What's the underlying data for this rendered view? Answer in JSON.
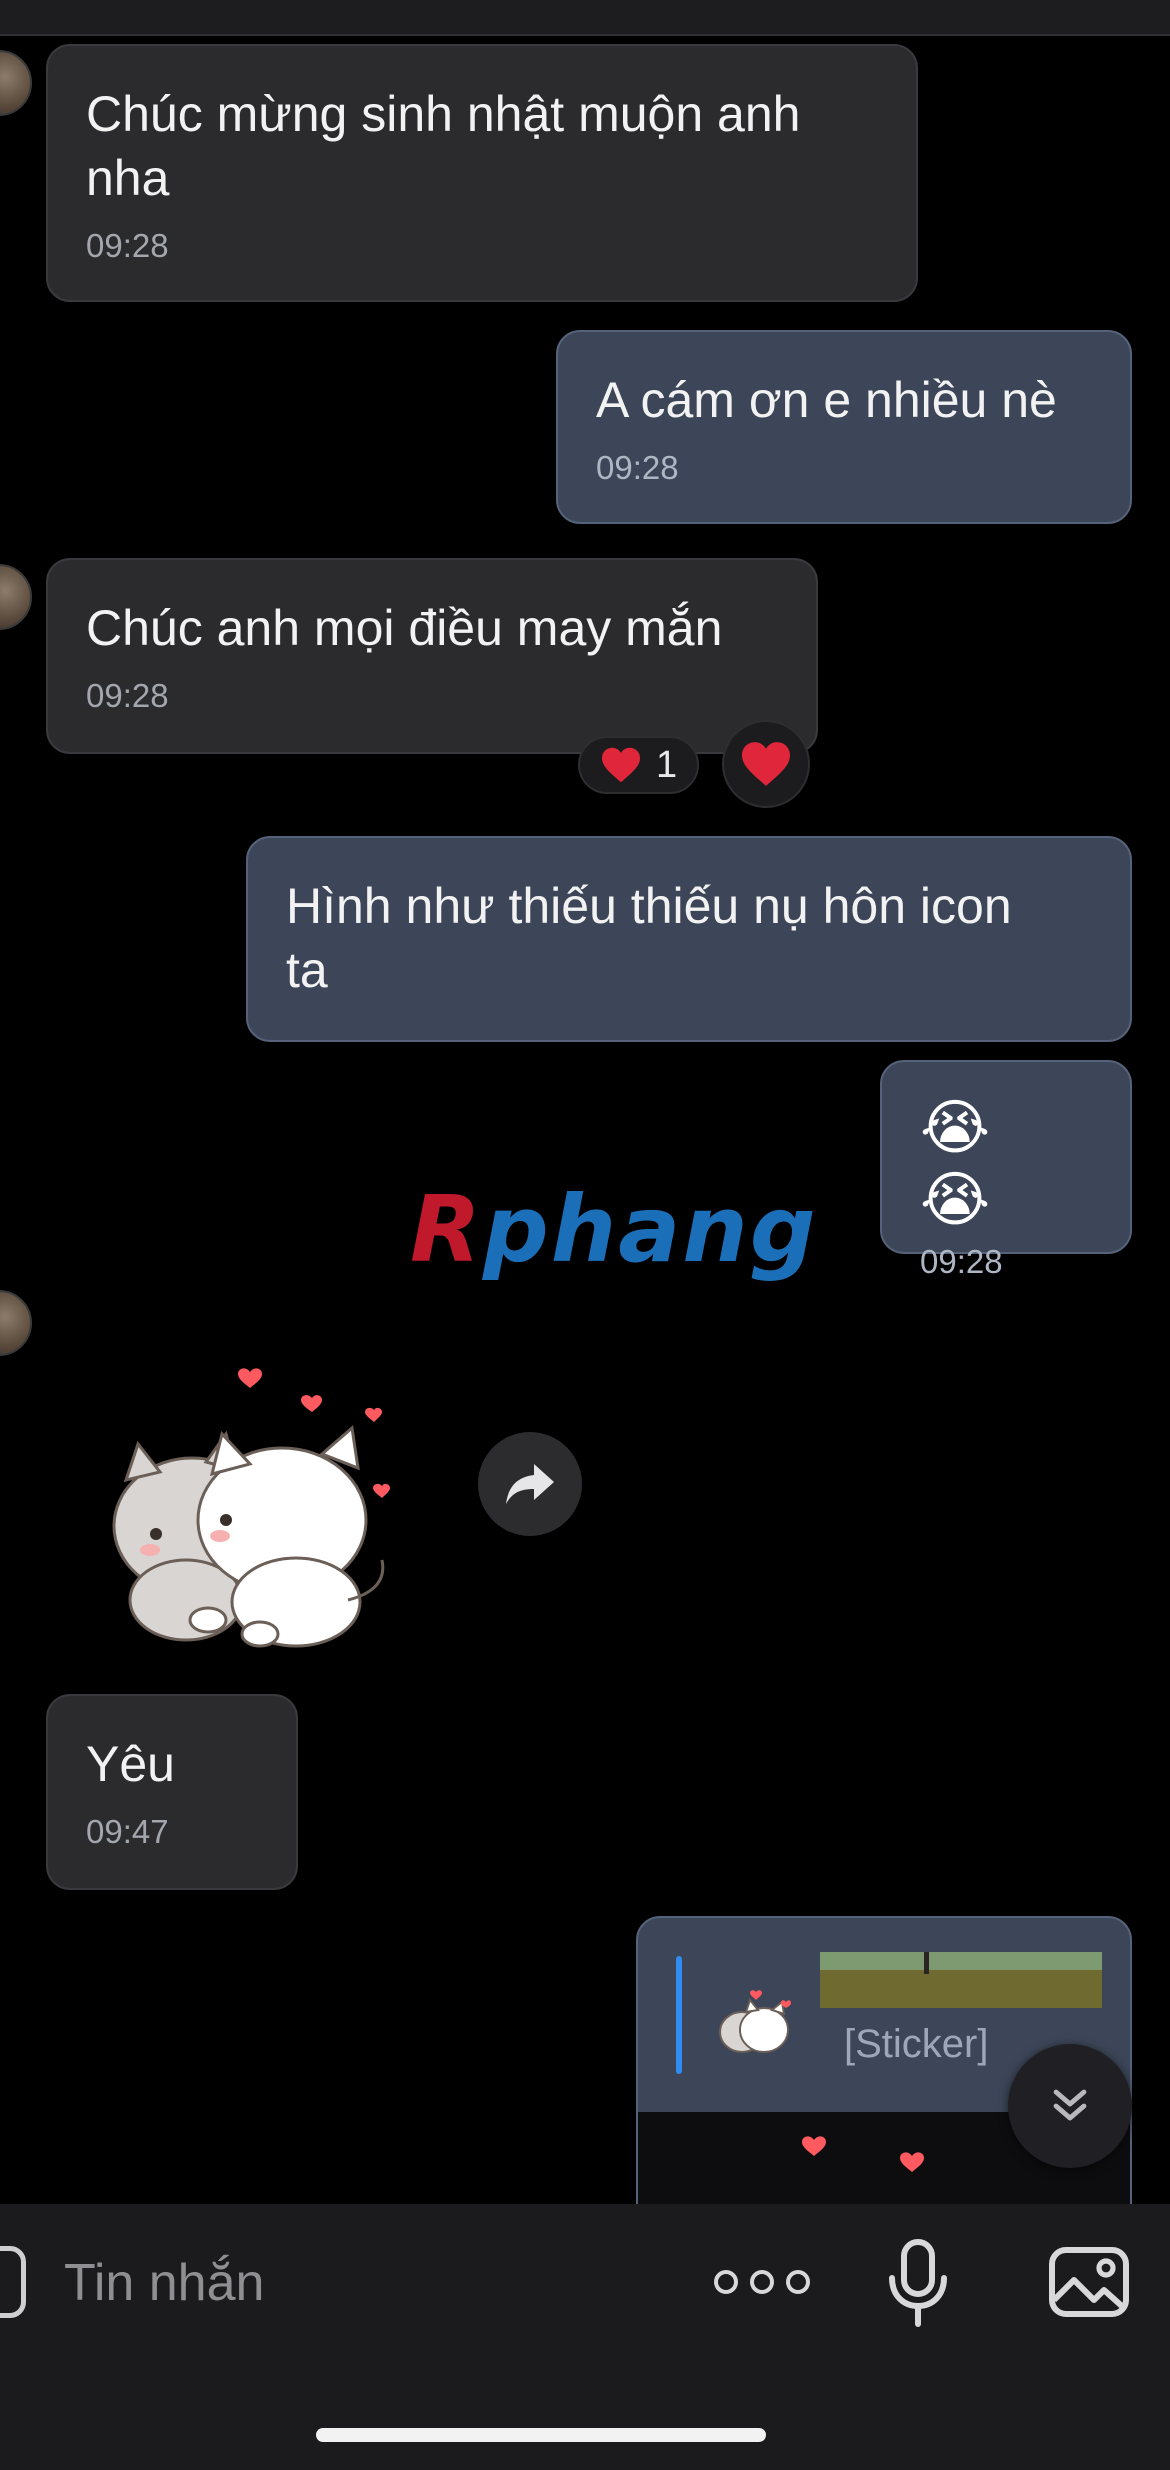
{
  "messages": [
    {
      "text": "Chúc mừng sinh nhật muộn anh\nnha",
      "time": "09:28"
    },
    {
      "text": "A cám ơn e nhiều nè",
      "time": "09:28"
    },
    {
      "text": "Chúc anh mọi điều may mắn",
      "time": "09:28"
    },
    {
      "text": "Hình như thiếu thiếu nụ hôn icon\nta"
    },
    {
      "emoji": "😭 😭",
      "time": "09:28"
    },
    {
      "text": "Yêu",
      "time": "09:47"
    }
  ],
  "reactions": {
    "emoji": "❤️",
    "count": "1"
  },
  "watermark": {
    "part1": "R",
    "part2": "phang"
  },
  "reply": {
    "label": "[Sticker]"
  },
  "input": {
    "placeholder": "Tin nhắn"
  },
  "icons": [
    "share-icon",
    "scroll-down-icon",
    "sticker-icon",
    "more-icon",
    "microphone-icon",
    "image-icon",
    "heart-icon"
  ],
  "colors": {
    "incoming_bubble": "#2b2b2e",
    "outgoing_bubble": "#3c4658",
    "reply_accent": "#2f8cf0",
    "heart": "#e0263a"
  }
}
